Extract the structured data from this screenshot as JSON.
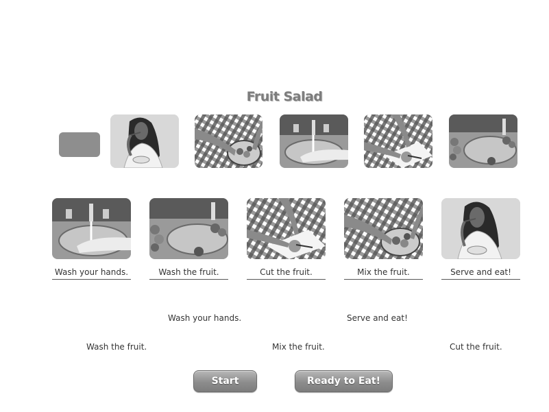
{
  "activity": {
    "title": "Fruit Salad"
  },
  "top_row": [
    {
      "scene": "girl-eating-icon"
    },
    {
      "scene": "mixing-fruit-icon"
    },
    {
      "scene": "washing-hands-icon"
    },
    {
      "scene": "cutting-fruit-icon"
    },
    {
      "scene": "washing-fruit-icon"
    }
  ],
  "steps": [
    {
      "label": "Wash your hands.",
      "scene": "washing-hands-icon"
    },
    {
      "label": "Wash the fruit.",
      "scene": "washing-fruit-icon"
    },
    {
      "label": "Cut the fruit.",
      "scene": "cutting-fruit-icon"
    },
    {
      "label": "Mix the fruit.",
      "scene": "mixing-fruit-icon"
    },
    {
      "label": "Serve and eat!",
      "scene": "girl-eating-icon"
    }
  ],
  "word_bank": [
    "Wash your hands.",
    "Serve and eat!",
    "Wash the fruit.",
    "Mix the fruit.",
    "Cut the fruit."
  ],
  "buttons": {
    "start": "Start",
    "ready": "Ready to Eat!"
  }
}
